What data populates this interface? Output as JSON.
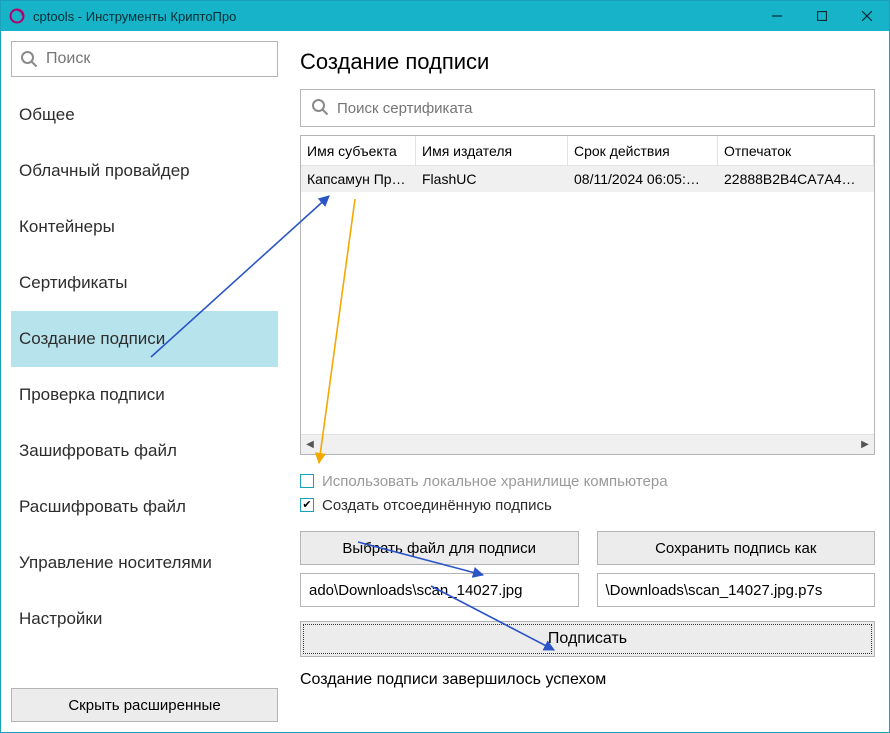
{
  "titlebar": {
    "title": "cptools - Инструменты КриптоПро"
  },
  "sidebar": {
    "search_placeholder": "Поиск",
    "items": [
      {
        "label": "Общее"
      },
      {
        "label": "Облачный провайдер"
      },
      {
        "label": "Контейнеры"
      },
      {
        "label": "Сертификаты"
      },
      {
        "label": "Создание подписи",
        "selected": true
      },
      {
        "label": "Проверка подписи"
      },
      {
        "label": "Зашифровать файл"
      },
      {
        "label": "Расшифровать файл"
      },
      {
        "label": "Управление носителями"
      },
      {
        "label": "Настройки"
      }
    ],
    "hide_advanced": "Скрыть расширенные"
  },
  "main": {
    "title": "Создание подписи",
    "cert_search_placeholder": "Поиск сертификата",
    "columns": [
      "Имя субъекта",
      "Имя издателя",
      "Срок действия",
      "Отпечаток"
    ],
    "rows": [
      {
        "subject": "Капсамун Пр…",
        "issuer": "FlashUC",
        "validity": "08/11/2024 06:05:…",
        "thumbprint": "22888B2B4CA7A4…",
        "selected": true
      }
    ],
    "checkbox_local": "Использовать локальное хранилище компьютера",
    "checkbox_detached": "Создать отсоединённую подпись",
    "btn_choose": "Выбрать файл для подписи",
    "btn_save_as": "Сохранить подпись как",
    "path_in": "ado\\Downloads\\scan_14027.jpg",
    "path_out": "\\Downloads\\scan_14027.jpg.p7s",
    "btn_sign": "Подписать",
    "status": "Создание подписи завершилось успехом"
  }
}
